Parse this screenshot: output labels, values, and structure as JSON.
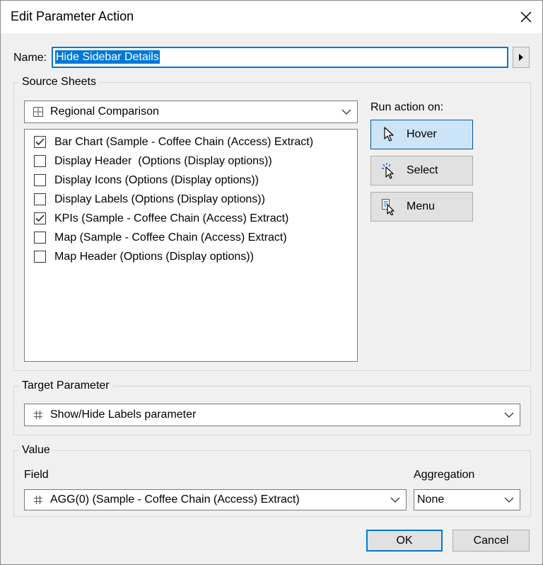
{
  "window": {
    "title": "Edit Parameter Action"
  },
  "name_field": {
    "label": "Name:",
    "value": "Hide Sidebar Details"
  },
  "source_sheets": {
    "group_title": "Source Sheets",
    "dashboard_select": {
      "value": "Regional Comparison",
      "icon": "grid-icon"
    },
    "sheets": [
      {
        "label": "Bar Chart (Sample - Coffee Chain (Access) Extract)",
        "checked": true
      },
      {
        "label": "Display Header  (Options (Display options))",
        "checked": false
      },
      {
        "label": "Display Icons (Options (Display options))",
        "checked": false
      },
      {
        "label": "Display Labels (Options (Display options))",
        "checked": false
      },
      {
        "label": "KPIs (Sample - Coffee Chain (Access) Extract)",
        "checked": true
      },
      {
        "label": "Map (Sample - Coffee Chain (Access) Extract)",
        "checked": false
      },
      {
        "label": "Map Header (Options (Display options))",
        "checked": false
      }
    ],
    "run_action": {
      "label": "Run action on:",
      "options": [
        {
          "label": "Hover",
          "icon": "hover-cursor-icon",
          "selected": true
        },
        {
          "label": "Select",
          "icon": "select-click-icon",
          "selected": false
        },
        {
          "label": "Menu",
          "icon": "menu-cursor-icon",
          "selected": false
        }
      ]
    }
  },
  "target_parameter": {
    "group_title": "Target Parameter",
    "value": "Show/Hide Labels parameter",
    "icon": "hash-icon"
  },
  "value_section": {
    "group_title": "Value",
    "field_label": "Field",
    "field_value": "AGG(0) (Sample - Coffee Chain (Access) Extract)",
    "field_icon": "hash-icon",
    "aggregation_label": "Aggregation",
    "aggregation_value": "None"
  },
  "buttons": {
    "ok": "OK",
    "cancel": "Cancel"
  },
  "colors": {
    "accent": "#0078d7",
    "selected_button_bg": "#cce4f7",
    "dialog_bg": "#f0f0f0"
  }
}
